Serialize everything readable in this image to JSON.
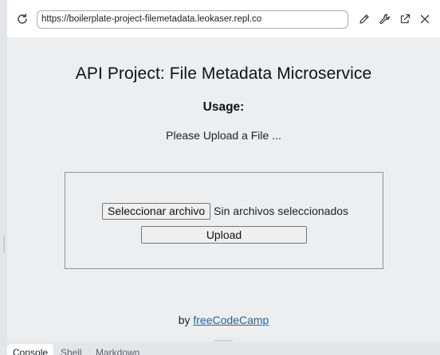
{
  "toolbar": {
    "reload_icon": "reload-icon",
    "url": "https://boilerplate-project-filemetadata.leokaser.repl.co",
    "edit_icon": "pencil-icon",
    "devtools_icon": "wrench-icon",
    "open_new_tab_icon": "external-link-icon",
    "close_icon": "close-icon"
  },
  "page": {
    "title": "API Project: File Metadata Microservice",
    "usage_heading": "Usage:",
    "usage_text": "Please Upload a File ...",
    "form": {
      "file_button_label": "Seleccionar archivo",
      "file_status": "Sin archivos seleccionados",
      "upload_label": "Upload"
    },
    "footer": {
      "prefix": "by",
      "link_text": "freeCodeCamp",
      "link_color": "#2a6496"
    }
  },
  "bottom_tabs": [
    {
      "label": "Console",
      "active": true
    },
    {
      "label": "Shell",
      "active": false
    },
    {
      "label": "Markdown",
      "active": false
    }
  ]
}
